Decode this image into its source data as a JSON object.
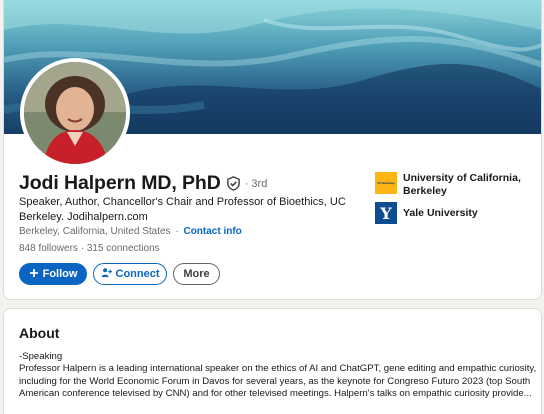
{
  "profile": {
    "name": "Jodi Halpern MD, PhD",
    "degree": "· 3rd",
    "headline": "Speaker, Author, Chancellor's Chair and Professor of Bioethics, UC Berkeley. Jodihalpern.com",
    "location": "Berkeley, California, United States",
    "separator": "·",
    "contact_info": "Contact info",
    "followers": "848 followers",
    "connections": "315 connections"
  },
  "actions": {
    "follow_label": "Follow",
    "connect_label": "Connect",
    "more_label": "More"
  },
  "education": [
    {
      "name": "University of California, Berkeley",
      "logo_text": "UC Berkeley"
    },
    {
      "name": "Yale University",
      "logo_text": "Y"
    }
  ],
  "about": {
    "title": "About",
    "line1": "-Speaking",
    "body": "Professor Halpern is a leading international speaker on the ethics of AI and ChatGPT, gene editing and empathic curiosity, including for the World Economic Forum in Davos for several years, as the keynote for Congreso Futuro 2023 (top South American conference televised by CNN) and for other televised meetings. Halpern's talks on empathic curiosity provide..."
  },
  "colors": {
    "brand_blue": "#0a66c2",
    "uc_gold": "#fdb515",
    "yale_blue": "#0f4d92"
  },
  "icons": {
    "verified": "shield-check-icon",
    "follow": "plus-icon",
    "connect": "person-add-icon"
  }
}
